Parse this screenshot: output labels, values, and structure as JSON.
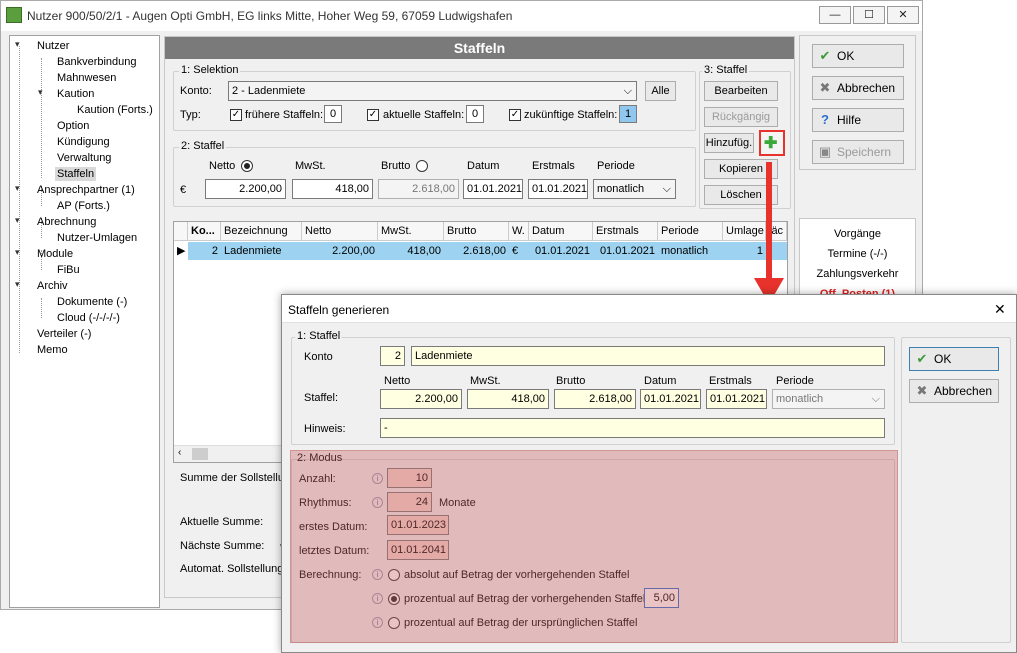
{
  "window": {
    "title": "Nutzer 900/50/2/1 - Augen Opti GmbH, EG links Mitte, Hoher Weg 59, 67059 Ludwigshafen",
    "minimize": "—",
    "maximize": "☐",
    "close": "✕"
  },
  "tree": {
    "items": [
      {
        "label": "Nutzer"
      },
      {
        "label": "Bankverbindung"
      },
      {
        "label": "Mahnwesen"
      },
      {
        "label": "Kaution"
      },
      {
        "label": "Kaution (Forts.)"
      },
      {
        "label": "Option"
      },
      {
        "label": "Kündigung"
      },
      {
        "label": "Verwaltung"
      },
      {
        "label": "Staffeln"
      },
      {
        "label": "Ansprechpartner (1)"
      },
      {
        "label": "AP (Forts.)"
      },
      {
        "label": "Abrechnung"
      },
      {
        "label": "Nutzer-Umlagen"
      },
      {
        "label": "Module"
      },
      {
        "label": "FiBu"
      },
      {
        "label": "Archiv"
      },
      {
        "label": "Dokumente (-)"
      },
      {
        "label": "Cloud (-/-/-/-)"
      },
      {
        "label": "Verteiler (-)"
      },
      {
        "label": "Memo"
      }
    ]
  },
  "panel": {
    "title": "Staffeln",
    "selektion": {
      "label": "1: Selektion",
      "konto_label": "Konto:",
      "konto_value": "2 - Ladenmiete",
      "alle": "Alle",
      "typ_label": "Typ:",
      "fruehere": "frühere Staffeln:",
      "fruehere_count": "0",
      "aktuelle": "aktuelle Staffeln:",
      "aktuelle_count": "0",
      "zukuenftige": "zukünftige Staffeln:",
      "zukuenftige_count": "1"
    },
    "staffel": {
      "label": "2: Staffel",
      "netto": "Netto",
      "mwst": "MwSt.",
      "brutto": "Brutto",
      "datum": "Datum",
      "erstmals": "Erstmals",
      "periode": "Periode",
      "currency": "€",
      "netto_value": "2.200,00",
      "mwst_value": "418,00",
      "brutto_value": "2.618,00",
      "datum_value": "01.01.2021",
      "erstmals_value": "01.01.2021",
      "periode_value": "monatlich"
    },
    "staffel3": {
      "label": "3: Staffel",
      "bearbeiten": "Bearbeiten",
      "rueckgaengig": "Rückgängig",
      "hinzufueg": "Hinzufüg.",
      "kopieren": "Kopieren",
      "loeschen": "Löschen"
    },
    "grid": {
      "columns": [
        "Ko...",
        "Bezeichnung",
        "Netto",
        "MwSt.",
        "Brutto",
        "W.",
        "Datum",
        "Erstmals",
        "Periode",
        "Umlage",
        "läc"
      ],
      "row": [
        "2",
        "Ladenmiete",
        "2.200,00",
        "418,00",
        "2.618,00",
        "€",
        "01.01.2021",
        "01.01.2021",
        "monatlich",
        "1"
      ]
    },
    "summary": {
      "summe": "Summe der Sollstellun",
      "aktuelle": "Aktuelle Summe:",
      "naechste": "Nächste Summe:",
      "naechste_cur": "€",
      "automat": "Automat. Sollstellung:"
    }
  },
  "right": {
    "ok": "OK",
    "abbrechen": "Abbrechen",
    "hilfe": "Hilfe",
    "speichern": "Speichern",
    "vorgaenge": "Vorgänge",
    "termine": "Termine (-/-)",
    "zahlungsverkehr": "Zahlungsverkehr",
    "offposten": "Off. Posten (1)"
  },
  "dialog": {
    "title": "Staffeln generieren",
    "close": "✕",
    "staffel_label": "1: Staffel",
    "konto_label": "Konto",
    "konto_num": "2",
    "konto_name": "Ladenmiete",
    "staffel_label2": "Staffel:",
    "netto": "Netto",
    "mwst": "MwSt.",
    "brutto": "Brutto",
    "datum": "Datum",
    "erstmals": "Erstmals",
    "periode": "Periode",
    "netto_value": "2.200,00",
    "mwst_value": "418,00",
    "brutto_value": "2.618,00",
    "datum_value": "01.01.2021",
    "erstmals_value": "01.01.2021",
    "periode_value": "monatlich",
    "hinweis_label": "Hinweis:",
    "hinweis_value": "-",
    "modus_label": "2: Modus",
    "anzahl_label": "Anzahl:",
    "anzahl_value": "10",
    "rhythmus_label": "Rhythmus:",
    "rhythmus_value": "24",
    "rhythmus_unit": "Monate",
    "erstes_label": "erstes Datum:",
    "erstes_value": "01.01.2023",
    "letztes_label": "letztes Datum:",
    "letztes_value": "01.01.2041",
    "berechnung_label": "Berechnung:",
    "opt1": "absolut auf Betrag der vorhergehenden Staffel",
    "opt2": "prozentual auf Betrag der vorhergehenden Staffel",
    "opt2_value": "5,00",
    "opt3": "prozentual auf Betrag der ursprünglichen Staffel",
    "ok": "OK",
    "abbrechen": "Abbrechen"
  },
  "colors": {
    "highlight_row": "#9dd3f0",
    "annotation_red": "#e8322c",
    "header_gray": "#7a7a7a"
  }
}
